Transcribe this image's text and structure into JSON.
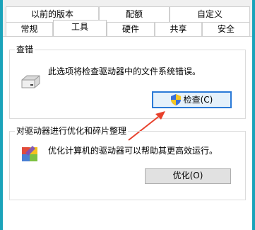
{
  "tabs_back": [
    {
      "label": "以前的版本"
    },
    {
      "label": "配额"
    },
    {
      "label": "自定义"
    }
  ],
  "tabs_front": [
    {
      "label": "常规",
      "selected": false
    },
    {
      "label": "工具",
      "selected": true
    },
    {
      "label": "硬件",
      "selected": false
    },
    {
      "label": "共享",
      "selected": false
    },
    {
      "label": "安全",
      "selected": false
    }
  ],
  "error_check": {
    "title": "查错",
    "description": "此选项将检查驱动器中的文件系统错误。",
    "button_label": "检查(C)"
  },
  "optimize": {
    "title": "对驱动器进行优化和碎片整理",
    "description": "优化计算机的驱动器可以帮助其更高效运行。",
    "button_label": "优化(O)"
  },
  "colors": {
    "window_frame": "#1aa3ba",
    "focus_border": "#2b7ad7",
    "arrow": "#e8412c"
  }
}
